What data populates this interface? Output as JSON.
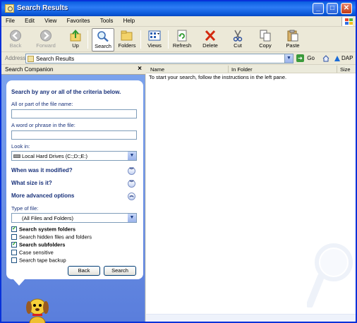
{
  "window": {
    "title": "Search Results"
  },
  "menu": [
    "File",
    "Edit",
    "View",
    "Favorites",
    "Tools",
    "Help"
  ],
  "toolbar": {
    "back": "Back",
    "forward": "Forward",
    "up": "Up",
    "search": "Search",
    "folders": "Folders",
    "views": "Views",
    "refresh": "Refresh",
    "delete": "Delete",
    "cut": "Cut",
    "copy": "Copy",
    "paste": "Paste"
  },
  "address": {
    "label": "Address",
    "value": "Search Results",
    "go": "Go",
    "link": "DAP"
  },
  "left_pane": {
    "title": "Search Companion",
    "heading": "Search by any or all of the criteria below.",
    "filename_label": "All or part of the file name:",
    "filename_value": "",
    "phrase_label": "A word or phrase in the file:",
    "phrase_value": "",
    "lookin_label": "Look in:",
    "lookin_value": "Local Hard Drives (C:;D:;E:)",
    "modified_label": "When was it modified?",
    "size_label": "What size is it?",
    "advanced_label": "More advanced options",
    "type_label": "Type of file:",
    "type_value": "(All Files and Folders)",
    "options": [
      {
        "label": "Search system folders",
        "checked": true
      },
      {
        "label": "Search hidden files and folders",
        "checked": false
      },
      {
        "label": "Search subfolders",
        "checked": true
      },
      {
        "label": "Case sensitive",
        "checked": false
      },
      {
        "label": "Search tape backup",
        "checked": false
      }
    ],
    "back_button": "Back",
    "search_button": "Search"
  },
  "results": {
    "columns": [
      "Name",
      "In Folder",
      "Size"
    ],
    "instructions": "To start your search, follow the instructions in the left pane."
  },
  "colors": {
    "title_bar": "#0a5de0",
    "pane_blue": "#6f8fe0",
    "heading_text": "#18317a"
  }
}
